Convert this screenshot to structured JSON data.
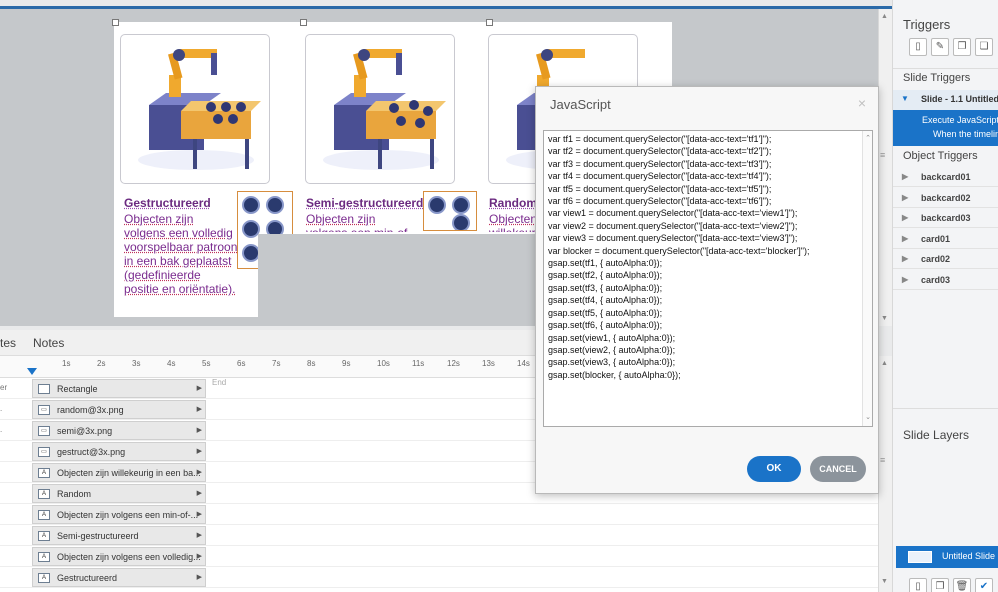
{
  "slide": {
    "cards": [
      {
        "title": "Gestructureerd",
        "body": "Objecten zijn volgens een volledig voorspelbaar patroon in een bak geplaatst (gedefinieerde positie en oriëntatie)."
      },
      {
        "title": "Semi-gestructureerd",
        "body": "Objecten zijn volgens een min-of-meer"
      },
      {
        "title": "Random",
        "body": "Objecten willekeurig"
      }
    ]
  },
  "sidebar": {
    "triggers_title": "Triggers",
    "toolbar_icons": [
      "new-icon",
      "edit-icon",
      "copy-icon",
      "paste-icon"
    ],
    "slide_triggers_title": "Slide Triggers",
    "slide_trigger_row": "Slide - 1.1 Untitled",
    "trigger_action_line1": "Execute JavaScript",
    "trigger_action_line2": "When the timeline",
    "object_triggers_title": "Object Triggers",
    "objects": [
      "backcard01",
      "backcard02",
      "backcard03",
      "card01",
      "card02",
      "card03"
    ],
    "slide_layers_title": "Slide Layers",
    "layer_item": "Untitled Slide",
    "accent_color": "#1a73c8"
  },
  "timeline": {
    "tabs": [
      "tes",
      "Notes"
    ],
    "ticks": [
      "1s",
      "2s",
      "3s",
      "4s",
      "5s",
      "6s",
      "7s",
      "8s",
      "9s",
      "10s",
      "11s",
      "12s",
      "13s",
      "14s"
    ],
    "end_label": "End",
    "layers": [
      {
        "name": "er",
        "label": "Rectangle",
        "icon": "rectangle-icon"
      },
      {
        "name": ".",
        "label": "random@3x.png",
        "icon": "image-icon"
      },
      {
        "name": ".",
        "label": "semi@3x.png",
        "icon": "image-icon"
      },
      {
        "name": "",
        "label": "gestruct@3x.png",
        "icon": "image-icon"
      },
      {
        "name": "",
        "label": "Objecten zijn willekeurig in een ba...",
        "icon": "text-icon"
      },
      {
        "name": "",
        "label": "Random",
        "icon": "text-icon"
      },
      {
        "name": "",
        "label": "Objecten zijn volgens een min-of-...",
        "icon": "text-icon"
      },
      {
        "name": "",
        "label": "Semi-gestructureerd",
        "icon": "text-icon"
      },
      {
        "name": "",
        "label": "Objecten zijn volgens een volledig...",
        "icon": "text-icon"
      },
      {
        "name": "",
        "label": "Gestructureerd",
        "icon": "text-icon"
      }
    ]
  },
  "dialog": {
    "title": "JavaScript",
    "close": "×",
    "code": "var tf1 = document.querySelector(\"[data-acc-text='tf1']\");\nvar tf2 = document.querySelector(\"[data-acc-text='tf2']\");\nvar tf3 = document.querySelector(\"[data-acc-text='tf3']\");\nvar tf4 = document.querySelector(\"[data-acc-text='tf4']\");\nvar tf5 = document.querySelector(\"[data-acc-text='tf5']\");\nvar tf6 = document.querySelector(\"[data-acc-text='tf6']\");\nvar view1 = document.querySelector(\"[data-acc-text='view1']\");\nvar view2 = document.querySelector(\"[data-acc-text='view2']\");\nvar view3 = document.querySelector(\"[data-acc-text='view3']\");\nvar blocker = document.querySelector(\"[data-acc-text='blocker']\");\ngsap.set(tf1, { autoAlpha:0});\ngsap.set(tf2, { autoAlpha:0});\ngsap.set(tf3, { autoAlpha:0});\ngsap.set(tf4, { autoAlpha:0});\ngsap.set(tf5, { autoAlpha:0});\ngsap.set(tf6, { autoAlpha:0});\ngsap.set(view1, { autoAlpha:0});\ngsap.set(view2, { autoAlpha:0});\ngsap.set(view3, { autoAlpha:0});\ngsap.set(blocker, { autoAlpha:0});",
    "ok_label": "OK",
    "cancel_label": "CANCEL"
  }
}
